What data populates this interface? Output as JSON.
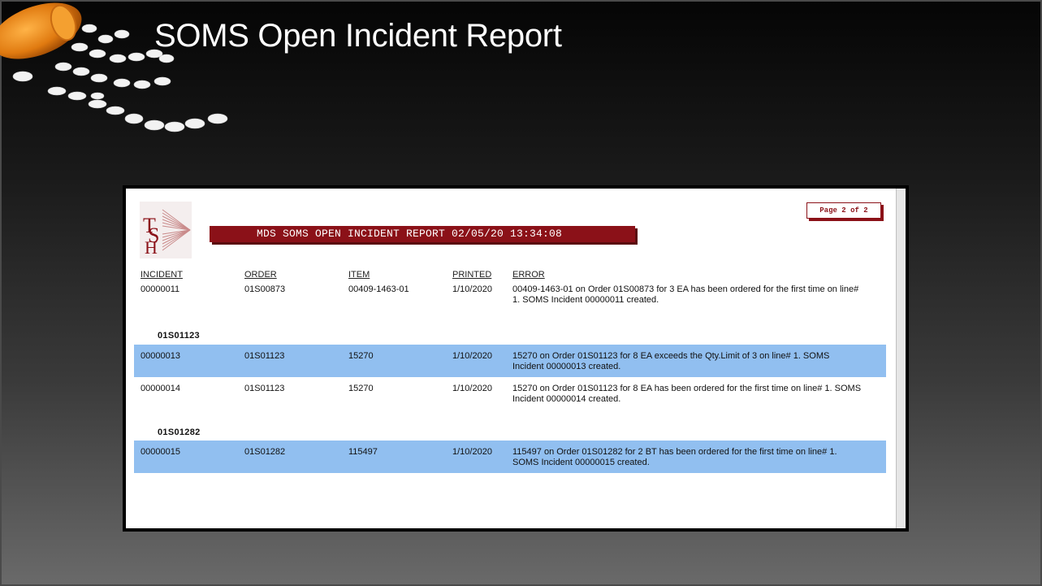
{
  "slide": {
    "title": "SOMS Open Incident Report"
  },
  "report": {
    "banner_title": "MDS SOMS OPEN INCIDENT REPORT 02/05/20 13:34:08",
    "page_label": "Page 2 of 2",
    "logo_text": "TSH",
    "columns": [
      "INCIDENT",
      "ORDER",
      "ITEM",
      "PRINTED",
      "ERROR"
    ],
    "rows": [
      {
        "incident": "00000011",
        "order": "01S00873",
        "item": "00409-1463-01",
        "printed": "1/10/2020",
        "error": "00409-1463-01 on Order 01S00873 for 3 EA has been ordered for the first time on line# 1. SOMS Incident 00000011 created."
      },
      {
        "incident": "00000013",
        "order": "01S01123",
        "item": "15270",
        "printed": "1/10/2020",
        "error": "15270 on Order 01S01123 for 8 EA exceeds the Qty.Limit of 3 on line# 1. SOMS Incident 00000013 created."
      },
      {
        "incident": "00000014",
        "order": "01S01123",
        "item": "15270",
        "printed": "1/10/2020",
        "error": "15270 on Order 01S01123 for 8 EA has been ordered for the first time on line# 1. SOMS Incident 00000014 created."
      },
      {
        "incident": "00000015",
        "order": "01S01282",
        "item": "115497",
        "printed": "1/10/2020",
        "error": "115497 on Order 01S01282 for 2 BT has been ordered for the first time on line# 1. SOMS Incident 00000015 created."
      }
    ],
    "groups": [
      "01S01123",
      "01S01282"
    ]
  },
  "colors": {
    "banner": "#8b1118",
    "highlight_row": "#91bff0",
    "title_text": "#ffffff"
  }
}
